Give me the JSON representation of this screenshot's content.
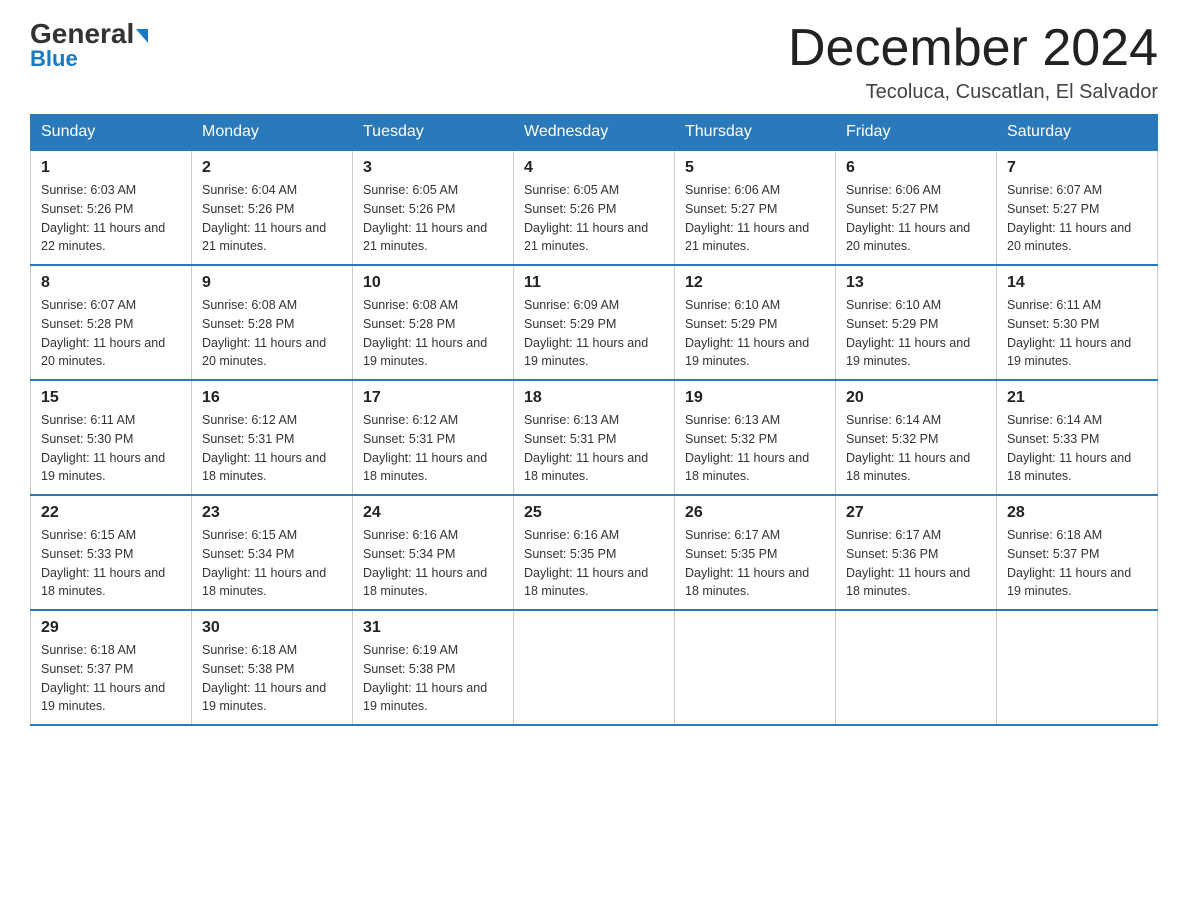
{
  "header": {
    "logo_general": "General",
    "logo_blue": "Blue",
    "month_title": "December 2024",
    "location": "Tecoluca, Cuscatlan, El Salvador"
  },
  "days_of_week": [
    "Sunday",
    "Monday",
    "Tuesday",
    "Wednesday",
    "Thursday",
    "Friday",
    "Saturday"
  ],
  "weeks": [
    [
      {
        "day": "1",
        "sunrise": "6:03 AM",
        "sunset": "5:26 PM",
        "daylight": "11 hours and 22 minutes."
      },
      {
        "day": "2",
        "sunrise": "6:04 AM",
        "sunset": "5:26 PM",
        "daylight": "11 hours and 21 minutes."
      },
      {
        "day": "3",
        "sunrise": "6:05 AM",
        "sunset": "5:26 PM",
        "daylight": "11 hours and 21 minutes."
      },
      {
        "day": "4",
        "sunrise": "6:05 AM",
        "sunset": "5:26 PM",
        "daylight": "11 hours and 21 minutes."
      },
      {
        "day": "5",
        "sunrise": "6:06 AM",
        "sunset": "5:27 PM",
        "daylight": "11 hours and 21 minutes."
      },
      {
        "day": "6",
        "sunrise": "6:06 AM",
        "sunset": "5:27 PM",
        "daylight": "11 hours and 20 minutes."
      },
      {
        "day": "7",
        "sunrise": "6:07 AM",
        "sunset": "5:27 PM",
        "daylight": "11 hours and 20 minutes."
      }
    ],
    [
      {
        "day": "8",
        "sunrise": "6:07 AM",
        "sunset": "5:28 PM",
        "daylight": "11 hours and 20 minutes."
      },
      {
        "day": "9",
        "sunrise": "6:08 AM",
        "sunset": "5:28 PM",
        "daylight": "11 hours and 20 minutes."
      },
      {
        "day": "10",
        "sunrise": "6:08 AM",
        "sunset": "5:28 PM",
        "daylight": "11 hours and 19 minutes."
      },
      {
        "day": "11",
        "sunrise": "6:09 AM",
        "sunset": "5:29 PM",
        "daylight": "11 hours and 19 minutes."
      },
      {
        "day": "12",
        "sunrise": "6:10 AM",
        "sunset": "5:29 PM",
        "daylight": "11 hours and 19 minutes."
      },
      {
        "day": "13",
        "sunrise": "6:10 AM",
        "sunset": "5:29 PM",
        "daylight": "11 hours and 19 minutes."
      },
      {
        "day": "14",
        "sunrise": "6:11 AM",
        "sunset": "5:30 PM",
        "daylight": "11 hours and 19 minutes."
      }
    ],
    [
      {
        "day": "15",
        "sunrise": "6:11 AM",
        "sunset": "5:30 PM",
        "daylight": "11 hours and 19 minutes."
      },
      {
        "day": "16",
        "sunrise": "6:12 AM",
        "sunset": "5:31 PM",
        "daylight": "11 hours and 18 minutes."
      },
      {
        "day": "17",
        "sunrise": "6:12 AM",
        "sunset": "5:31 PM",
        "daylight": "11 hours and 18 minutes."
      },
      {
        "day": "18",
        "sunrise": "6:13 AM",
        "sunset": "5:31 PM",
        "daylight": "11 hours and 18 minutes."
      },
      {
        "day": "19",
        "sunrise": "6:13 AM",
        "sunset": "5:32 PM",
        "daylight": "11 hours and 18 minutes."
      },
      {
        "day": "20",
        "sunrise": "6:14 AM",
        "sunset": "5:32 PM",
        "daylight": "11 hours and 18 minutes."
      },
      {
        "day": "21",
        "sunrise": "6:14 AM",
        "sunset": "5:33 PM",
        "daylight": "11 hours and 18 minutes."
      }
    ],
    [
      {
        "day": "22",
        "sunrise": "6:15 AM",
        "sunset": "5:33 PM",
        "daylight": "11 hours and 18 minutes."
      },
      {
        "day": "23",
        "sunrise": "6:15 AM",
        "sunset": "5:34 PM",
        "daylight": "11 hours and 18 minutes."
      },
      {
        "day": "24",
        "sunrise": "6:16 AM",
        "sunset": "5:34 PM",
        "daylight": "11 hours and 18 minutes."
      },
      {
        "day": "25",
        "sunrise": "6:16 AM",
        "sunset": "5:35 PM",
        "daylight": "11 hours and 18 minutes."
      },
      {
        "day": "26",
        "sunrise": "6:17 AM",
        "sunset": "5:35 PM",
        "daylight": "11 hours and 18 minutes."
      },
      {
        "day": "27",
        "sunrise": "6:17 AM",
        "sunset": "5:36 PM",
        "daylight": "11 hours and 18 minutes."
      },
      {
        "day": "28",
        "sunrise": "6:18 AM",
        "sunset": "5:37 PM",
        "daylight": "11 hours and 19 minutes."
      }
    ],
    [
      {
        "day": "29",
        "sunrise": "6:18 AM",
        "sunset": "5:37 PM",
        "daylight": "11 hours and 19 minutes."
      },
      {
        "day": "30",
        "sunrise": "6:18 AM",
        "sunset": "5:38 PM",
        "daylight": "11 hours and 19 minutes."
      },
      {
        "day": "31",
        "sunrise": "6:19 AM",
        "sunset": "5:38 PM",
        "daylight": "11 hours and 19 minutes."
      },
      null,
      null,
      null,
      null
    ]
  ]
}
